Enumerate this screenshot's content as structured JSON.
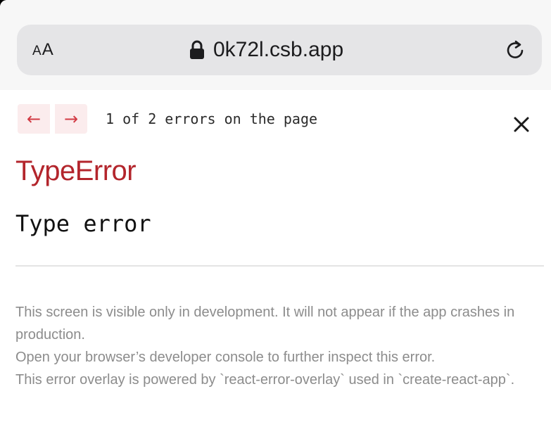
{
  "browser": {
    "text_size_label_small": "A",
    "text_size_label_large": "A",
    "url": "0k72l.csb.app",
    "icons": {
      "lock": "lock-icon",
      "reload": "reload-icon"
    }
  },
  "overlay": {
    "prev_label": "←",
    "next_label": "→",
    "error_count": "1 of 2 errors on the page",
    "close_label": "×",
    "error_type": "TypeError",
    "error_message": "Type error",
    "footer": [
      "This screen is visible only in development. It will not appear if the app crashes in production.",
      "Open your browser’s developer console to further inspect this error.",
      "This error overlay is powered by `react-error-overlay` used in `create-react-app`."
    ],
    "colors": {
      "error_red": "#b3252c",
      "nav_bg": "#fbeced",
      "nav_arrow": "#d23a44",
      "footer_text": "#8c8c8c"
    }
  }
}
